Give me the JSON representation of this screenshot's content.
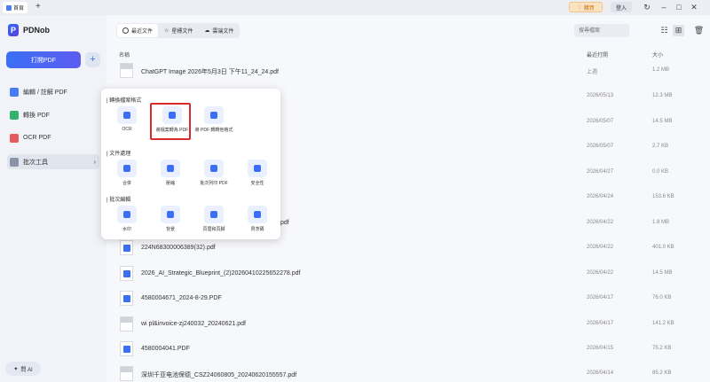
{
  "titlebar": {
    "home_tab": "首頁",
    "new_tab": "+",
    "upgrade": "購買",
    "login": "登入",
    "icons": [
      "refresh-icon",
      "minimize-icon",
      "maximize-icon",
      "close-icon"
    ]
  },
  "sidebar": {
    "brand": "PDNob",
    "open_pdf": "打開PDF",
    "add": "+",
    "items": [
      {
        "label": "編輯 / 註解 PDF",
        "icon": "edit-icon",
        "color": "#4a7cf7"
      },
      {
        "label": "轉換 PDF",
        "icon": "convert-icon",
        "color": "#33b46b"
      },
      {
        "label": "OCR PDF",
        "icon": "ocr-icon",
        "color": "#e35b5b"
      },
      {
        "label": "批次工具",
        "icon": "batch-icon",
        "color": "#8a93a8"
      }
    ],
    "ai": "問 AI"
  },
  "main": {
    "tabs": [
      {
        "label": "最近文件",
        "active": true
      },
      {
        "label": "星標文件",
        "active": false
      },
      {
        "label": "雲端文件",
        "active": false
      }
    ],
    "search_placeholder": "搜尋檔案",
    "columns": {
      "name": "名稱",
      "date": "最近打開",
      "size": "大小"
    },
    "files": [
      {
        "name": "ChatGPT Image 2026年5月3日 下午11_24_24.pdf",
        "date": "上週",
        "size": "1.2 MB",
        "thumb": "img"
      },
      {
        "name": "",
        "date": "2026/05/13",
        "size": "12.3 MB",
        "thumb": "pdf"
      },
      {
        "name": "",
        "date": "2026/05/07",
        "size": "14.5 MB",
        "thumb": "pdf"
      },
      {
        "name": "",
        "date": "2026/05/07",
        "size": "2.7 KB",
        "thumb": "pdf"
      },
      {
        "name": "",
        "date": "2026/04/27",
        "size": "0.0 KB",
        "thumb": "pdf"
      },
      {
        "name": "",
        "date": "2026/04/24",
        "size": "153.6 KB",
        "thumb": "pdf"
      },
      {
        "name": "pdf",
        "date": "2026/04/22",
        "size": "1.8 MB",
        "thumb": "pdf"
      },
      {
        "name": "224N68300006389(32).pdf",
        "date": "2026/04/22",
        "size": "401.0 KB",
        "thumb": "pdf"
      },
      {
        "name": "2026_AI_Strategic_Blueprint_(2)20260410225652278.pdf",
        "date": "2026/04/22",
        "size": "14.5 MB",
        "thumb": "pdf"
      },
      {
        "name": "4580004671_2024-8-29.PDF",
        "date": "2026/04/17",
        "size": "76.0 KB",
        "thumb": "pdf"
      },
      {
        "name": "wi pl&invoice-zj240032_20240621.pdf",
        "date": "2026/04/17",
        "size": "141.2 KB",
        "thumb": "img"
      },
      {
        "name": "4580004041.PDF",
        "date": "2026/04/15",
        "size": "75.2 KB",
        "thumb": "pdf"
      },
      {
        "name": "深圳千亚电池保德_CSZ24060805_20240620155557.pdf",
        "date": "2026/04/14",
        "size": "85.2 KB",
        "thumb": "img"
      }
    ]
  },
  "popover": {
    "sections": [
      {
        "title": "| 轉換檔案格式",
        "items": [
          "OCR",
          "將檔案轉為 PDF",
          "將 PDF 轉轉他格式"
        ]
      },
      {
        "title": "| 文件處理",
        "items": [
          "合併",
          "壓縮",
          "批次列印 PDF",
          "安全性"
        ]
      },
      {
        "title": "| 批次編輯",
        "items": [
          "水印",
          "背景",
          "頁眉和頁腳",
          "貝茨碼"
        ]
      }
    ],
    "highlighted": "將檔案轉為 PDF"
  }
}
